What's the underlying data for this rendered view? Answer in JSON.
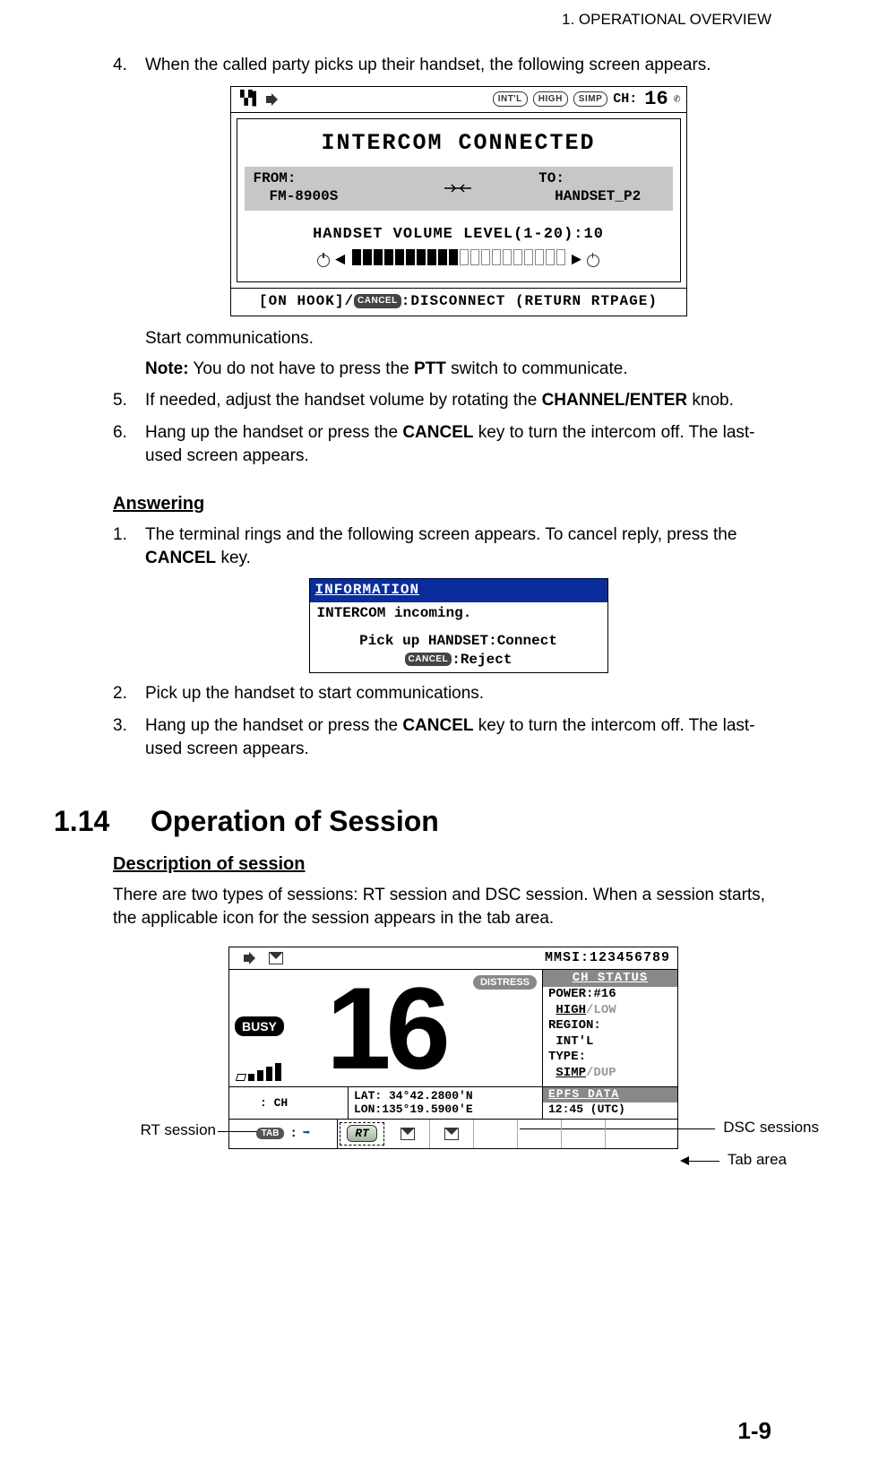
{
  "running_header": "1.  OPERATIONAL OVERVIEW",
  "page_number": "1-9",
  "steps_top": {
    "s4": {
      "num": "4.",
      "text": "When the called party picks up their handset, the following screen appears."
    },
    "sub_a": "Start communications.",
    "sub_note_prefix": "Note:",
    "sub_note_rest": " You do not have to press the ",
    "sub_note_bold": "PTT",
    "sub_note_end": " switch to communicate.",
    "s5": {
      "num": "5.",
      "pre": "If needed, adjust the handset volume by rotating the ",
      "bold": "CHANNEL/ENTER",
      "post": " knob."
    },
    "s6": {
      "num": "6.",
      "pre": "Hang up the handset or press the ",
      "bold": "CANCEL",
      "post": " key to turn the intercom off. The last-used screen appears."
    }
  },
  "fig1": {
    "pill_intl": "INT'L",
    "pill_high": "HIGH",
    "pill_simp": "SIMP",
    "ch_label": "CH:",
    "ch_num": "16",
    "title": "INTERCOM CONNECTED",
    "from_label": "FROM:",
    "from_val": "FM-8900S",
    "to_label": "TO:",
    "to_val": "HANDSET_P2",
    "vol_label": "HANDSET VOLUME LEVEL(1-20):10",
    "footer_pre": "[ON HOOK]/",
    "footer_badge": "CANCEL",
    "footer_post": ":DISCONNECT (RETURN RTPAGE)"
  },
  "answering_head": "Answering",
  "answering": {
    "a1": {
      "num": "1.",
      "pre": "The terminal rings and the following screen appears. To cancel reply, press the ",
      "bold": "CANCEL",
      "post": " key."
    },
    "a2": {
      "num": "2.",
      "text": "Pick up the handset to start communications."
    },
    "a3": {
      "num": "3.",
      "pre": "Hang up the handset or press the ",
      "bold": "CANCEL",
      "post": " key to turn the intercom off. The last-used screen appears."
    }
  },
  "fig2": {
    "header": "INFORMATION",
    "line1": "INTERCOM incoming.",
    "line2": "Pick up HANDSET:Connect",
    "line3_badge": "CANCEL",
    "line3_post": ":Reject"
  },
  "section": {
    "number": "1.14",
    "title": "Operation of Session"
  },
  "desc_head": "Description of session",
  "desc_para": "There are two types of sessions: RT session and DSC session. When a session starts, the applicable icon for the session appears in the tab area.",
  "fig3": {
    "mmsi": "MMSI:123456789",
    "distress": "DISTRESS",
    "busy": "BUSY",
    "bignum": "16",
    "status_hdr": "CH STATUS",
    "power_lbl": "POWER:#16",
    "high": "HIGH",
    "low": "/LOW",
    "region_lbl": "REGION:",
    "region_val": "INT'L",
    "type_lbl": "TYPE:",
    "simp": "SIMP",
    "dup": "/DUP",
    "ch_lbl": ": CH",
    "lat": "LAT: 34°42.2800'N",
    "lon": "LON:135°19.5900'E",
    "epfs_hdr": "EPFS DATA",
    "epfs_time": "12:45 (UTC)",
    "tab_badge": "TAB",
    "tab_colon": ":",
    "rt_label": "RT"
  },
  "callouts": {
    "rt": "RT session",
    "dsc": "DSC sessions",
    "tabarea": "Tab area"
  }
}
